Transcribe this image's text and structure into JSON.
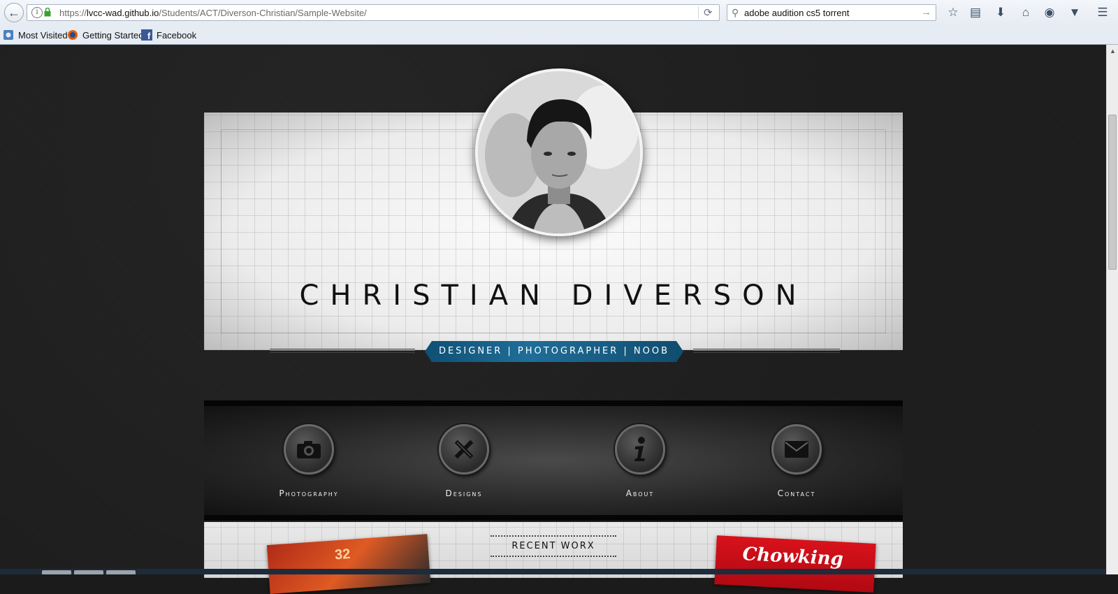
{
  "browser": {
    "url_prefix": "https://",
    "url_host": "lvcc-wad.github.io",
    "url_path": "/Students/ACT/Diverson-Christian/Sample-Website/",
    "search_value": "adobe audition cs5 torrent",
    "bookmarks": [
      {
        "label": "Most Visited",
        "icon": "most-visited-icon"
      },
      {
        "label": "Getting Started",
        "icon": "firefox-icon"
      },
      {
        "label": "Facebook",
        "icon": "facebook-icon"
      }
    ],
    "toolbar_icons": [
      "star-icon",
      "reading-list-icon",
      "download-icon",
      "home-icon",
      "chat-icon",
      "pocket-icon",
      "menu-icon"
    ]
  },
  "hero": {
    "name": "CHRISTIAN DIVERSON",
    "tagline": "DESIGNER | PHOTOGRAPHER | NOOB"
  },
  "nav": {
    "items": [
      {
        "label": "Photography",
        "icon": "camera-icon"
      },
      {
        "label": "Designs",
        "icon": "pencil-ruler-icon"
      },
      {
        "label": "About",
        "icon": "info-icon"
      },
      {
        "label": "Contact",
        "icon": "envelope-icon"
      }
    ]
  },
  "recent": {
    "title": "RECENT WORX",
    "left_thumb_text": "32",
    "right_thumb_text": "Chowking"
  },
  "colors": {
    "tagline_blue": "#1f6e99",
    "page_bg": "#1b1b1b",
    "nav_bg": "#262626"
  }
}
